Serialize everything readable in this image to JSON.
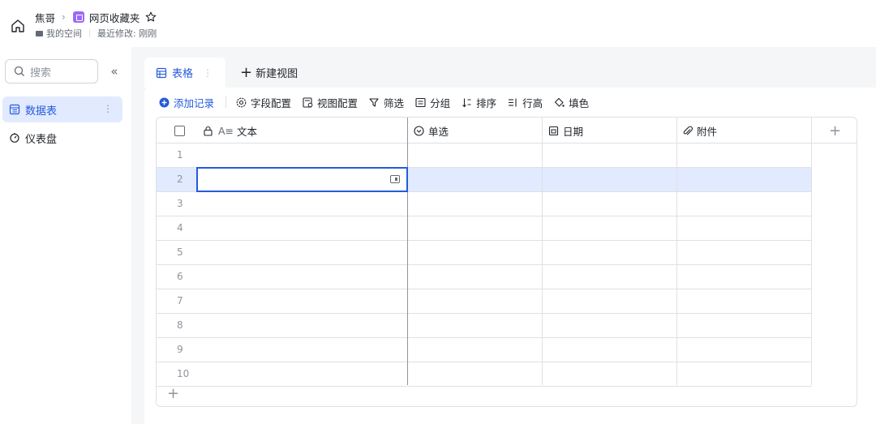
{
  "header": {
    "breadcrumb_parent": "焦哥",
    "breadcrumb_separator": "›",
    "doc_title": "网页收藏夹",
    "space_name": "我的空间",
    "last_modified": "最近修改: 刚刚"
  },
  "sidebar": {
    "search_placeholder": "搜索",
    "collapse_glyph": "«",
    "items": [
      {
        "label": "数据表",
        "icon": "table-icon",
        "active": true
      },
      {
        "label": "仪表盘",
        "icon": "dashboard-icon",
        "active": false
      }
    ],
    "more_glyph": "⋮"
  },
  "tabs": {
    "active_label": "表格",
    "more_glyph": "⋮",
    "new_view_label": "新建视图"
  },
  "toolbar": {
    "add_record": "添加记录",
    "field_config": "字段配置",
    "view_config": "视图配置",
    "filter": "筛选",
    "group": "分组",
    "sort": "排序",
    "row_height": "行高",
    "fill_color": "填色"
  },
  "grid": {
    "columns": [
      {
        "label": "文本",
        "type_glyph": "A≡",
        "icon": "text-field-icon"
      },
      {
        "label": "单选",
        "icon": "single-select-icon"
      },
      {
        "label": "日期",
        "icon": "date-icon"
      },
      {
        "label": "附件",
        "icon": "attachment-icon"
      }
    ],
    "row_numbers": [
      "1",
      "2",
      "3",
      "4",
      "5",
      "6",
      "7",
      "8",
      "9",
      "10"
    ],
    "selected_row": "2",
    "add_glyph": "+"
  },
  "colors": {
    "accent": "#245bdb",
    "accent_bg": "#e1eaff",
    "doc_badge": "#9b6af5",
    "border": "#dee0e3"
  }
}
